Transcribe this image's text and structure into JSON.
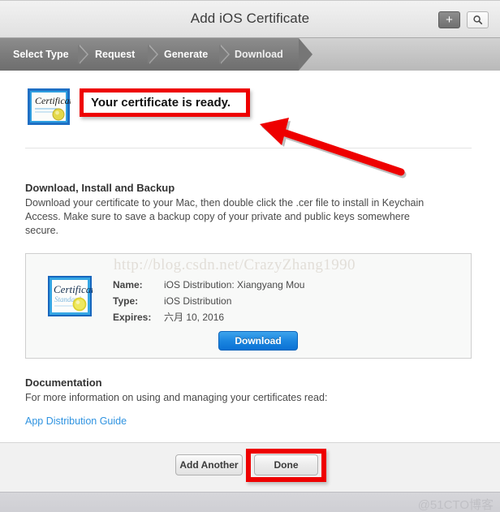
{
  "window": {
    "title": "Add iOS Certificate"
  },
  "titlebar": {
    "add_button_glyph": "+",
    "add_button_name": "add-button",
    "search_button_name": "search-button"
  },
  "steps": {
    "items": [
      {
        "label": "Select Type",
        "state": "completed"
      },
      {
        "label": "Request",
        "state": "completed"
      },
      {
        "label": "Generate",
        "state": "completed"
      },
      {
        "label": "Download",
        "state": "current"
      }
    ]
  },
  "ready": {
    "message": "Your certificate is ready.",
    "icon": "certificate-icon"
  },
  "download_section": {
    "heading": "Download, Install and Backup",
    "body": "Download your certificate to your Mac, then double click the .cer file to install in Keychain Access. Make sure to save a backup copy of your private and public keys somewhere secure."
  },
  "certificate": {
    "watermark": "http://blog.csdn.net/CrazyZhang1990",
    "icon": "certificate-icon",
    "fields": [
      {
        "label": "Name:",
        "value": "iOS Distribution: Xiangyang Mou"
      },
      {
        "label": "Type:",
        "value": "iOS Distribution"
      },
      {
        "label": "Expires:",
        "value": "六月 10, 2016"
      }
    ],
    "download_button": "Download"
  },
  "documentation": {
    "heading": "Documentation",
    "body": "For more information on using and managing your certificates read:",
    "link": "App Distribution Guide"
  },
  "footer": {
    "add_another": "Add Another",
    "done": "Done"
  },
  "watermarks": {
    "bottom_right": "@51CTO博客"
  },
  "annotations": {
    "highlight_color": "#ee0000",
    "arrow_name": "red-arrow-annotation",
    "ready_box_name": "red-highlight-ready",
    "done_box_name": "red-highlight-done"
  },
  "colors": {
    "accent_blue": "#1b86e0",
    "link_blue": "#2f93e0",
    "annotation_red": "#ee0000",
    "step_active": "#7c7c7c"
  }
}
